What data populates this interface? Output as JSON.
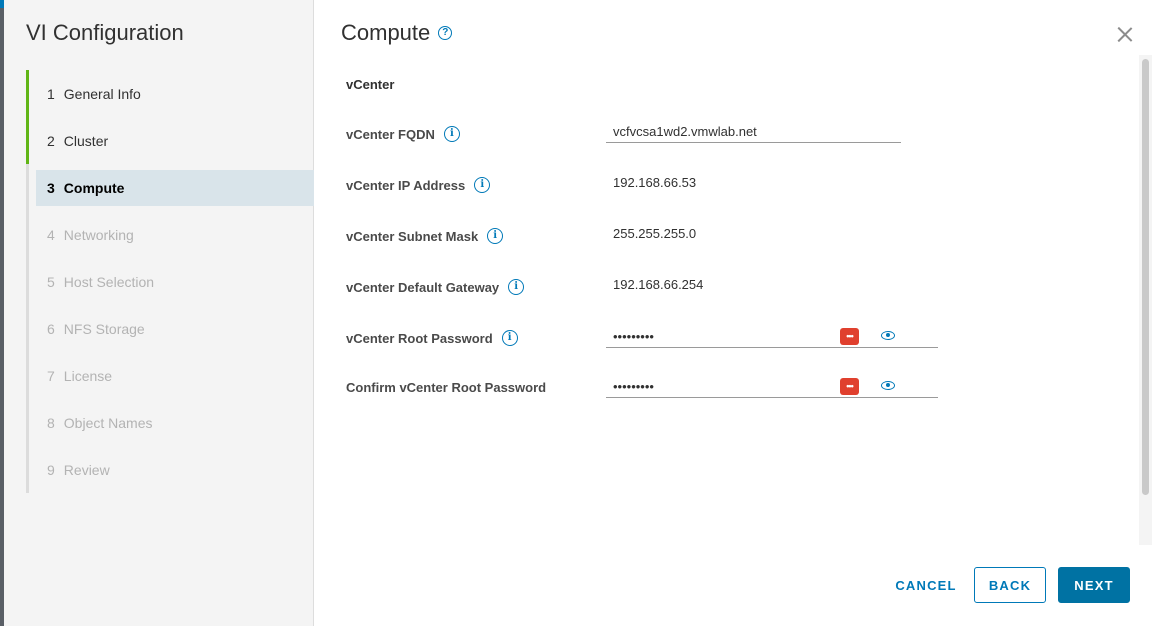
{
  "sidebar": {
    "title": "VI Configuration",
    "steps": [
      {
        "num": "1",
        "label": "General Info",
        "state": "done"
      },
      {
        "num": "2",
        "label": "Cluster",
        "state": "done"
      },
      {
        "num": "3",
        "label": "Compute",
        "state": "active"
      },
      {
        "num": "4",
        "label": "Networking",
        "state": "future"
      },
      {
        "num": "5",
        "label": "Host Selection",
        "state": "future"
      },
      {
        "num": "6",
        "label": "NFS Storage",
        "state": "future"
      },
      {
        "num": "7",
        "label": "License",
        "state": "future"
      },
      {
        "num": "8",
        "label": "Object Names",
        "state": "future"
      },
      {
        "num": "9",
        "label": "Review",
        "state": "future"
      }
    ]
  },
  "main": {
    "title": "Compute",
    "help_icon": "?",
    "section_title": "vCenter",
    "fields": {
      "fqdn": {
        "label": "vCenter FQDN",
        "value": "vcfvcsa1wd2.vmwlab.net"
      },
      "ip": {
        "label": "vCenter IP Address",
        "value": "192.168.66.53"
      },
      "subnet": {
        "label": "vCenter Subnet Mask",
        "value": "255.255.255.0"
      },
      "gateway": {
        "label": "vCenter Default Gateway",
        "value": "192.168.66.254"
      },
      "root_password": {
        "label": "vCenter Root Password",
        "value": "•••••••••"
      },
      "confirm_password": {
        "label": "Confirm vCenter Root Password",
        "value": "•••••••••"
      }
    },
    "info_icon": "i",
    "password_badge": "•••"
  },
  "footer": {
    "cancel_label": "CANCEL",
    "back_label": "BACK",
    "next_label": "NEXT"
  },
  "colors": {
    "accent": "#0079b8",
    "done_step": "#60b515",
    "active_step_bg": "#d9e4ea",
    "password_badge": "#e0402e"
  }
}
